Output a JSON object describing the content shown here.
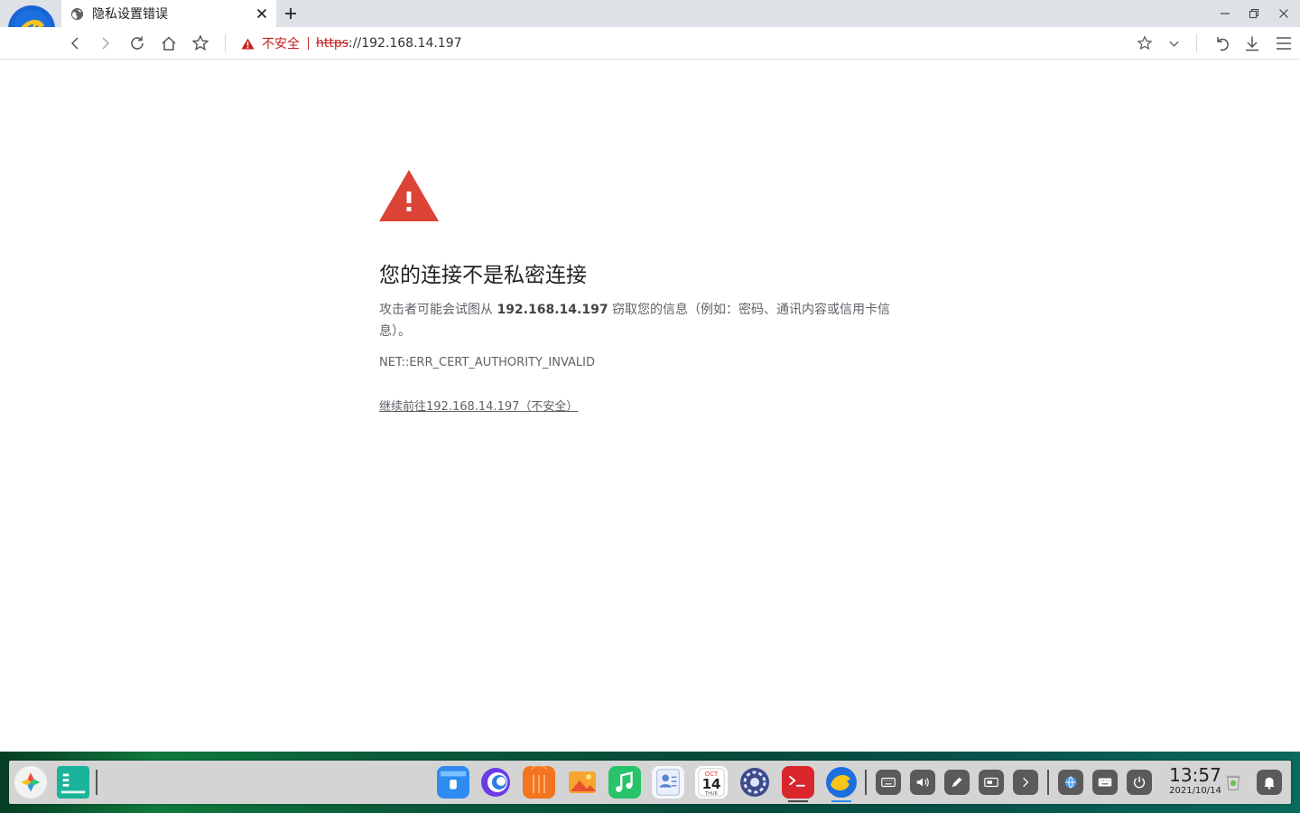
{
  "browser": {
    "tab": {
      "title": "隐私设置错误",
      "favicon": "globe-icon"
    },
    "new_tab_icon": "plus-icon",
    "window_controls": [
      "minimize-icon",
      "restore-icon",
      "close-icon"
    ],
    "toolbar": {
      "nav_icons": [
        "back-icon",
        "forward-icon",
        "reload-icon",
        "home-icon",
        "bookmark-star-icon"
      ],
      "security_label": "不安全",
      "url_scheme": "https",
      "url_rest": "://192.168.14.197",
      "right_icons": [
        "favorite-star-icon",
        "chevron-down-icon",
        "undo-icon",
        "download-icon",
        "menu-icon"
      ]
    }
  },
  "interstitial": {
    "heading": "您的连接不是私密连接",
    "desc_prefix": "攻击者可能会试图从 ",
    "desc_host": "192.168.14.197",
    "desc_suffix": " 窃取您的信息（例如：密码、通讯内容或信用卡信息）。",
    "error_code": "NET::ERR_CERT_AUTHORITY_INVALID",
    "proceed_link": "继续前往192.168.14.197（不安全）"
  },
  "taskbar": {
    "left_icons": [
      "start-menu-icon",
      "task-view-icon"
    ],
    "apps": [
      "file-manager-icon",
      "browser-swirl-icon",
      "app-store-icon",
      "image-viewer-icon",
      "music-icon",
      "contacts-icon",
      "calendar-icon",
      "settings-gear-icon",
      "terminal-icon",
      "browser-icon"
    ],
    "calendar": {
      "month": "OCT",
      "day": "14",
      "weekday": "THUR"
    },
    "tray": [
      "keyboard-icon",
      "volume-icon",
      "pen-icon",
      "screen-icon",
      "expand-arrow-icon",
      "network-icon",
      "input-method-icon",
      "power-icon"
    ],
    "clock": {
      "time": "13:57",
      "date": "2021/10/14"
    },
    "tray_end": [
      "recycle-bin-icon",
      "notification-bell-icon"
    ]
  },
  "colors": {
    "warning_red": "#db4437",
    "insecure_red": "#c5221f",
    "text_gray": "#5f6368"
  }
}
